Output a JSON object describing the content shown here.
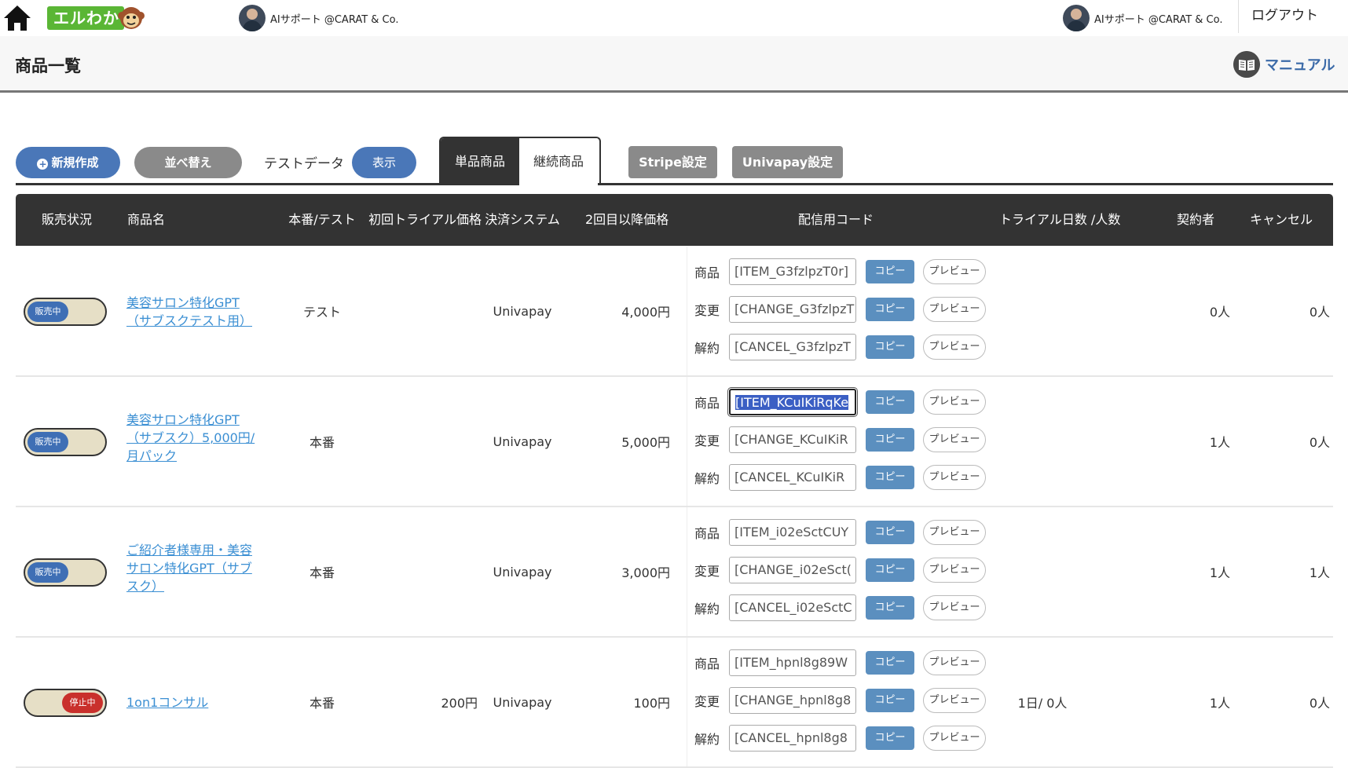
{
  "topbar": {
    "logo_text": "エルわか",
    "left_user": "AIサポート @CARAT & Co.",
    "right_user": "AIサポート @CARAT & Co.",
    "logout": "ログアウト"
  },
  "header": {
    "title": "商品一覧",
    "manual": "マニュアル"
  },
  "toolbar": {
    "new_button": "新規作成",
    "sort_button": "並べ替え",
    "testdata_label": "テストデータ",
    "show_button": "表示",
    "tabs": [
      {
        "label": "単品商品",
        "active": true
      },
      {
        "label": "継続商品",
        "active": false
      }
    ],
    "stripe_button": "Stripe設定",
    "univapay_button": "Univapay設定"
  },
  "table": {
    "headers": {
      "status": "販売状況",
      "name": "商品名",
      "env": "本番/テスト",
      "trial_price": "初回トライアル価格",
      "system": "決済システム",
      "second_price": "2回目以降価格",
      "code": "配信用コード",
      "trial_days": "トライアル日数 /人数",
      "subscribers": "契約者",
      "cancel": "キャンセル"
    },
    "code_labels": {
      "item": "商品",
      "change": "変更",
      "cancel": "解約"
    },
    "copy_label": "コピー",
    "preview_label": "プレビュー",
    "rows": [
      {
        "status": "販売中",
        "name": "美容サロン特化GPT（サブスクテスト用）",
        "env": "テスト",
        "trial_price": "",
        "system": "Univapay",
        "second_price": "4,000円",
        "item_code": "[ITEM_G3fzlpzT0r]",
        "change_code": "[CHANGE_G3fzlpzT",
        "cancel_code": "[CANCEL_G3fzlpzT",
        "trial_days": "",
        "subscribers": "0人",
        "cancels": "0人"
      },
      {
        "status": "販売中",
        "name": "美容サロン特化GPT（サブスク）5,000円/月パック",
        "env": "本番",
        "trial_price": "",
        "system": "Univapay",
        "second_price": "5,000円",
        "item_code": "[ITEM_KCuIKiRqKe",
        "change_code": "[CHANGE_KCuIKiR",
        "cancel_code": "[CANCEL_KCuIKiR",
        "trial_days": "",
        "subscribers": "1人",
        "cancels": "0人"
      },
      {
        "status": "販売中",
        "name": "ご紹介者様専用・美容サロン特化GPT（サブスク）",
        "env": "本番",
        "trial_price": "",
        "system": "Univapay",
        "second_price": "3,000円",
        "item_code": "[ITEM_i02eSctCUY",
        "change_code": "[CHANGE_i02eSct(",
        "cancel_code": "[CANCEL_i02eSctC",
        "trial_days": "",
        "subscribers": "1人",
        "cancels": "1人"
      },
      {
        "status": "停止中",
        "name": "1on1コンサル",
        "env": "本番",
        "trial_price": "200円",
        "system": "Univapay",
        "second_price": "100円",
        "item_code": "[ITEM_hpnl8g89W",
        "change_code": "[CHANGE_hpnl8g8",
        "cancel_code": "[CANCEL_hpnl8g8",
        "trial_days": "1日/ 0人",
        "subscribers": "1人",
        "cancels": "0人"
      }
    ]
  }
}
